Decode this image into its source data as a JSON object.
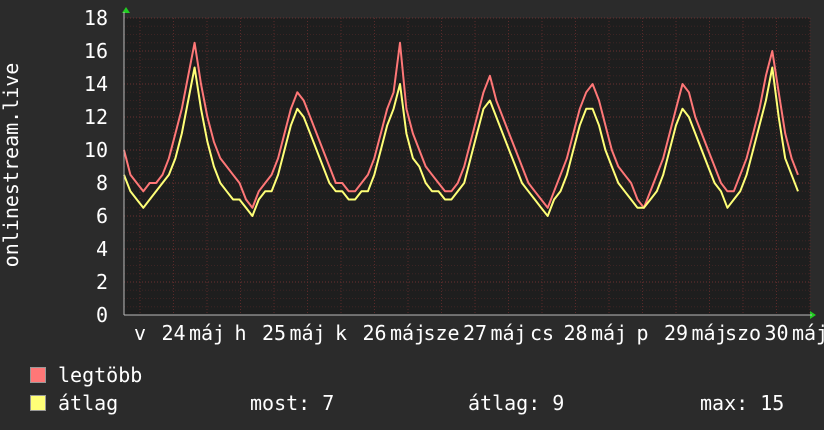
{
  "chart_data": {
    "type": "line",
    "ylabel": "onlinestream.live",
    "ylim": [
      0,
      18
    ],
    "yticks": [
      0,
      2,
      4,
      6,
      8,
      10,
      12,
      14,
      16,
      18
    ],
    "x_tick_labels": [
      "v",
      "24",
      "máj",
      "h",
      "25",
      "máj",
      "k",
      "26",
      "máj",
      "sze",
      "27",
      "máj",
      "cs",
      "28",
      "máj",
      "p",
      "29",
      "máj",
      "szo",
      "30",
      "máj"
    ],
    "grid": true,
    "legend": "bottom-left",
    "series": [
      {
        "name": "legtöbb",
        "color": "#ff7777",
        "values": [
          10,
          8.5,
          8,
          7.5,
          8,
          8,
          8.5,
          9.5,
          11,
          12.5,
          14.5,
          16.5,
          14,
          12,
          10.5,
          9.5,
          9,
          8.5,
          8,
          7,
          6.5,
          7.5,
          8,
          8.5,
          9.5,
          11,
          12.5,
          13.5,
          13,
          12,
          11,
          10,
          9,
          8,
          8,
          7.5,
          7.5,
          8,
          8.5,
          9.5,
          11,
          12.5,
          13.5,
          16.5,
          12.5,
          11,
          10,
          9,
          8.5,
          8,
          7.5,
          7.5,
          8,
          9,
          10.5,
          12,
          13.5,
          14.5,
          13,
          12,
          11,
          10,
          9,
          8,
          7.5,
          7,
          6.5,
          7.5,
          8.5,
          9.5,
          11,
          12.5,
          13.5,
          14,
          13,
          11.5,
          10,
          9,
          8.5,
          8,
          7,
          6.5,
          7.5,
          8.5,
          9.5,
          11,
          12.5,
          14,
          13.5,
          12,
          11,
          10,
          9,
          8,
          7.5,
          7.5,
          8.5,
          9.5,
          11,
          12.5,
          14.5,
          16,
          13.5,
          11,
          9.5,
          8.5
        ]
      },
      {
        "name": "átlag",
        "color": "#ffff77",
        "values": [
          8.5,
          7.5,
          7,
          6.5,
          7,
          7.5,
          8,
          8.5,
          9.5,
          11,
          13,
          15,
          12.5,
          10.5,
          9,
          8,
          7.5,
          7,
          7,
          6.5,
          6,
          7,
          7.5,
          7.5,
          8.5,
          10,
          11.5,
          12.5,
          12,
          11,
          10,
          9,
          8,
          7.5,
          7.5,
          7,
          7,
          7.5,
          7.5,
          8.5,
          10,
          11.5,
          12.5,
          14,
          11,
          9.5,
          9,
          8,
          7.5,
          7.5,
          7,
          7,
          7.5,
          8,
          9.5,
          11,
          12.5,
          13,
          12,
          11,
          10,
          9,
          8,
          7.5,
          7,
          6.5,
          6,
          7,
          7.5,
          8.5,
          10,
          11.5,
          12.5,
          12.5,
          11.5,
          10,
          9,
          8,
          7.5,
          7,
          6.5,
          6.5,
          7,
          7.5,
          8.5,
          10,
          11.5,
          12.5,
          12,
          11,
          10,
          9,
          8,
          7.5,
          6.5,
          7,
          7.5,
          8.5,
          10,
          11.5,
          13,
          15,
          12,
          9.5,
          8.5,
          7.5
        ]
      }
    ]
  },
  "legend": {
    "max_label": "legtöbb",
    "avg_label": "átlag"
  },
  "stats": {
    "now": "most: 7",
    "avg": "átlag: 9",
    "max": "max: 15"
  },
  "colors": {
    "background": "#2b2b2b",
    "plot_background": "#1e1e1e",
    "grid": "#5a2a2a",
    "arrow": "#22cc22"
  }
}
